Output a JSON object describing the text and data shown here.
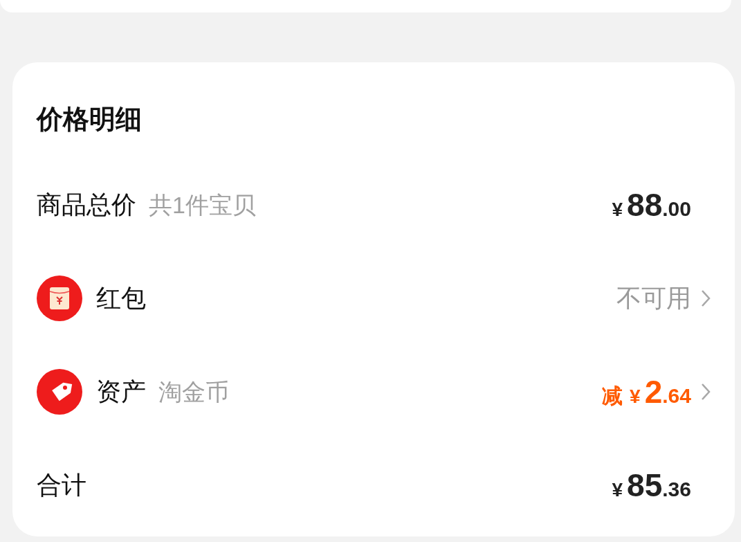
{
  "title": "价格明细",
  "rows": [
    {
      "kind": "plain",
      "label": "商品总价",
      "note": "共1件宝贝",
      "value": {
        "kind": "price",
        "currency": "¥",
        "integer": "88",
        "decimal": ".00"
      },
      "chevron": false
    },
    {
      "kind": "envelope",
      "label": "红包",
      "value": {
        "kind": "status",
        "text": "不可用"
      },
      "chevron": true
    },
    {
      "kind": "tag",
      "label": "资产",
      "note": "淘金币",
      "value": {
        "kind": "discount",
        "prefix": "减",
        "currency": "¥",
        "integer": "2",
        "decimal": ".64"
      },
      "chevron": true
    },
    {
      "kind": "plain",
      "label": "合计",
      "value": {
        "kind": "price",
        "currency": "¥",
        "integer": "85",
        "decimal": ".36"
      },
      "chevron": false
    }
  ]
}
